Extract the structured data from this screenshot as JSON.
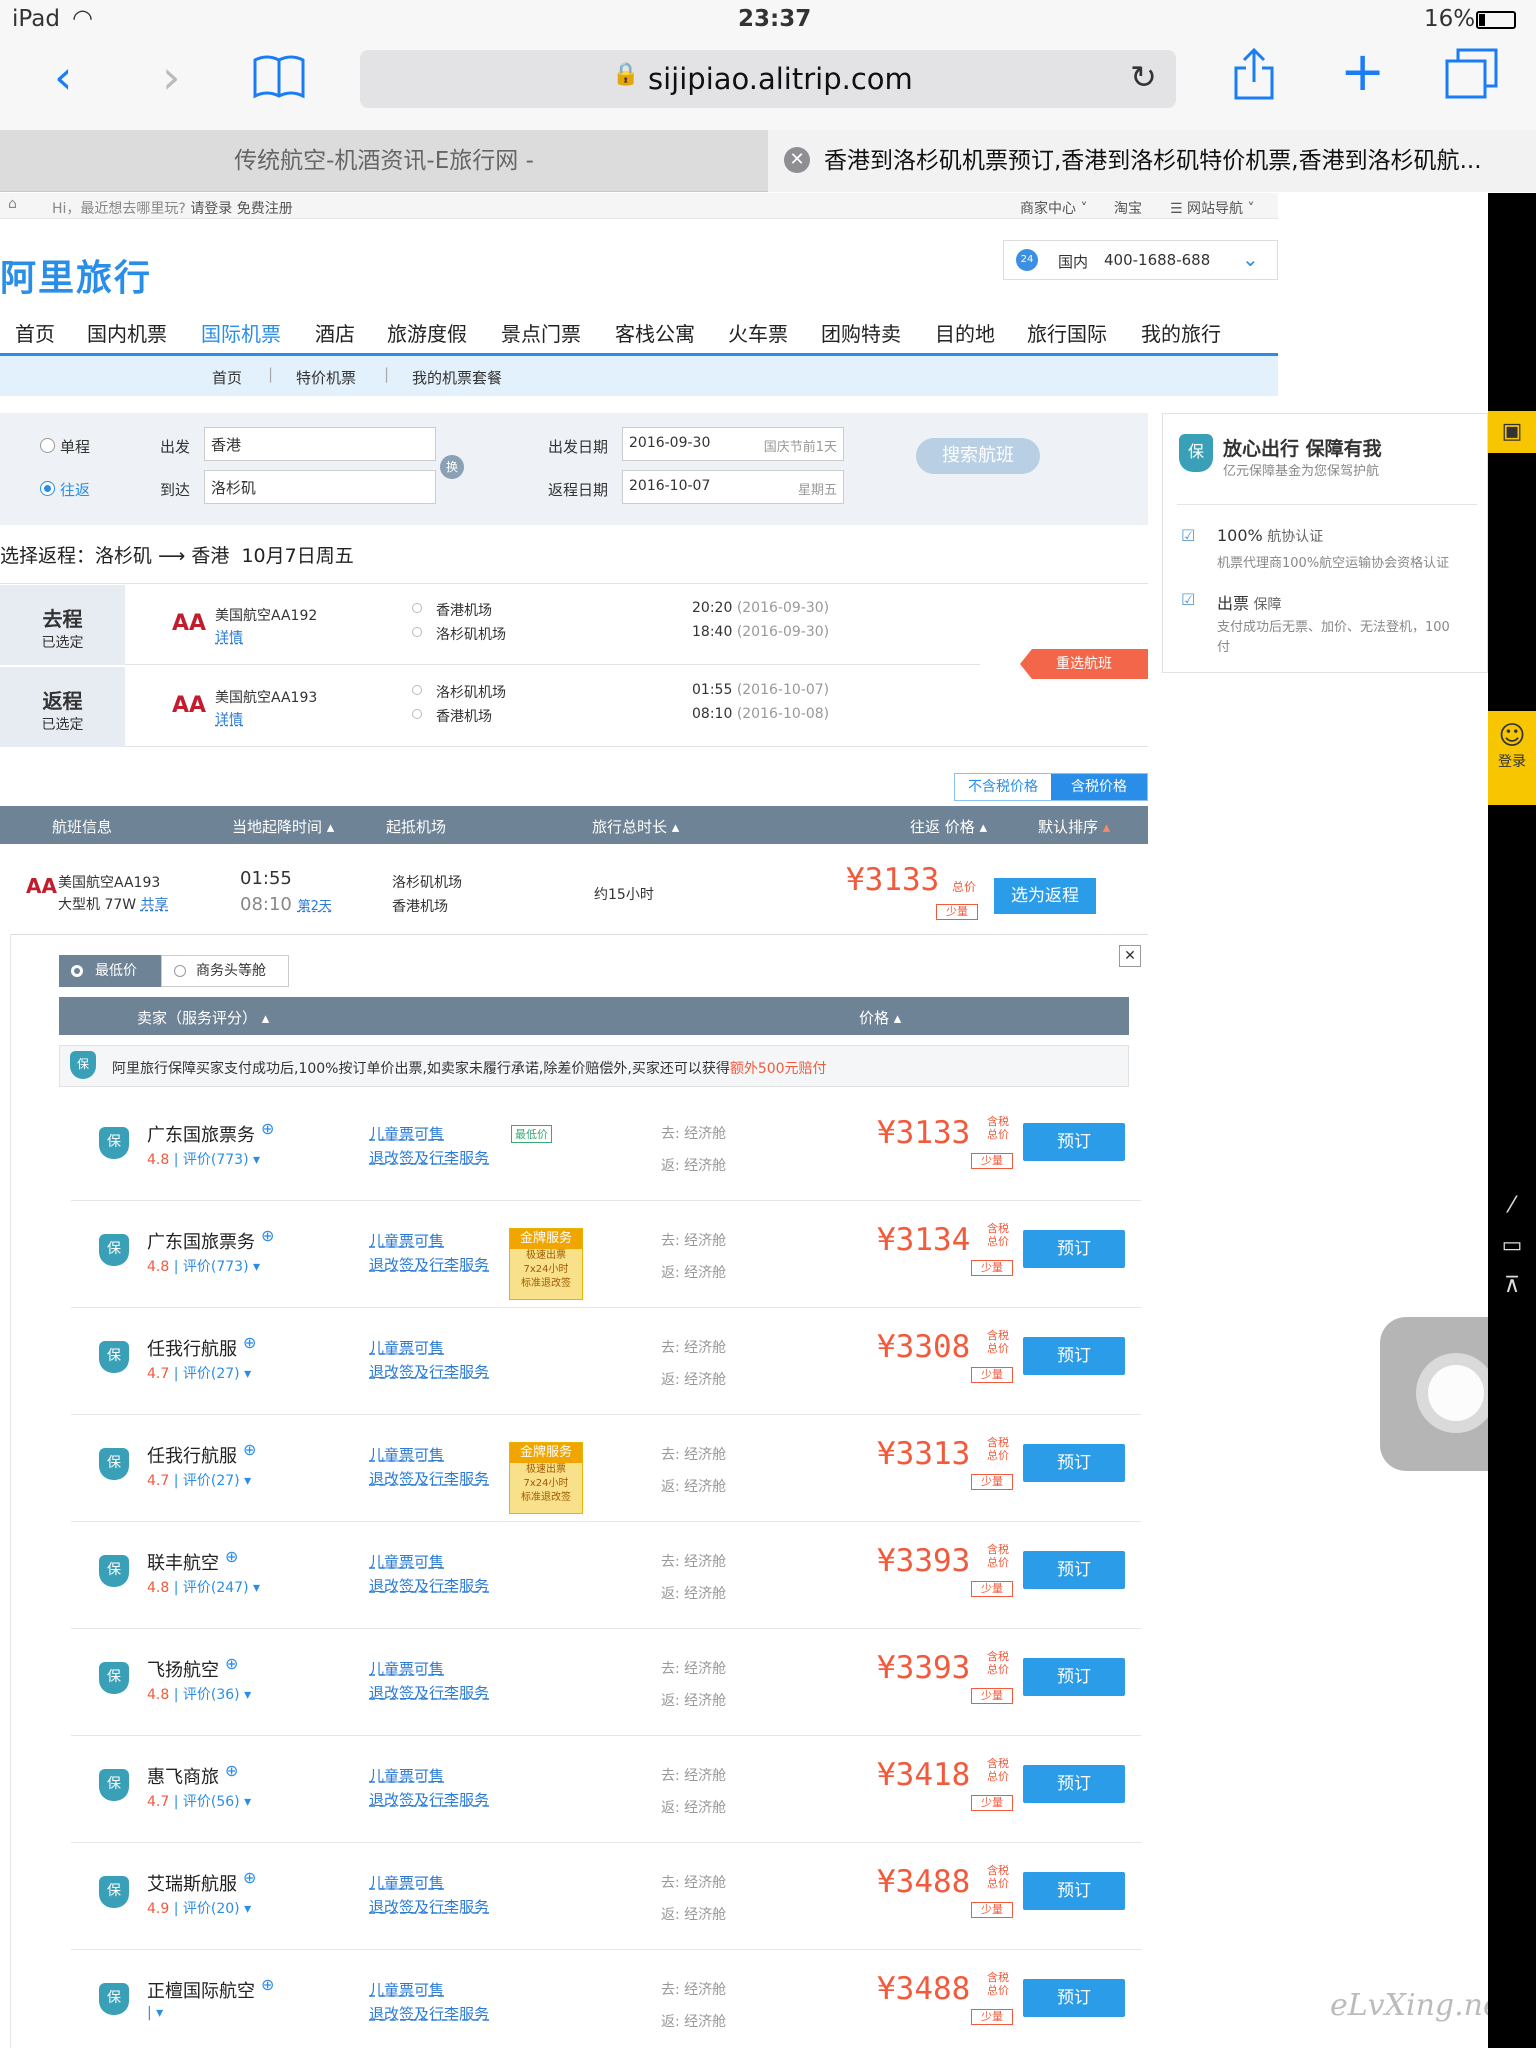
{
  "status": {
    "device": "iPad",
    "time": "23:37",
    "battery": "16%"
  },
  "browser": {
    "url": "sijipiao.alitrip.com"
  },
  "tabs": [
    {
      "title": "传统航空-机酒资讯-E旅行网 -"
    },
    {
      "title": "香港到洛杉矶机票预订,香港到洛杉矶特价机票,香港到洛杉矶航..."
    }
  ],
  "topbar": {
    "greeting": "Hi，最近想去哪里玩? ",
    "login": "请登录",
    "register": "免费注册",
    "merchant": "商家中心",
    "taobao": "淘宝",
    "sitenav": "网站导航"
  },
  "brand": {
    "logo": "阿里旅行",
    "hotline_label": "国内",
    "hotline": "400-1688-688"
  },
  "mainnav": [
    "首页",
    "国内机票",
    "国际机票",
    "酒店",
    "旅游度假",
    "景点门票",
    "客栈公寓",
    "火车票",
    "团购特卖",
    "目的地",
    "旅行国际",
    "我的旅行"
  ],
  "subnav": [
    "首页",
    "特价机票",
    "我的机票套餐"
  ],
  "search": {
    "oneway": "单程",
    "roundtrip": "往返",
    "from_label": "出发",
    "from": "香港",
    "to_label": "到达",
    "to": "洛杉矶",
    "swap": "换",
    "dep_label": "出发日期",
    "dep_date": "2016-09-30",
    "dep_note": "国庆节前1天",
    "ret_label": "返程日期",
    "ret_date": "2016-10-07",
    "ret_note": "星期五",
    "button": "搜索航班"
  },
  "guarantee": {
    "title": "放心出行 保障有我",
    "sub": "亿元保障基金为您保驾护航",
    "item1_title": "100%",
    "item1_title2": " 航协认证",
    "item1_desc": "机票代理商100%航空运输协会资格认证",
    "item2_title": "出票",
    "item2_title2": " 保障",
    "item2_desc": "支付成功后无票、加价、无法登机，100",
    "item2_desc2": "付"
  },
  "select_return": {
    "heading": "选择返程：洛杉矶",
    "arrow": "⟶",
    "dest": "香港",
    "date": "10月7日周五"
  },
  "trips": [
    {
      "label": "去程",
      "status": "已选定",
      "airline": "美国航空AA192",
      "detail": "详情",
      "dep_airport": "香港机场",
      "arr_airport": "洛杉矶机场",
      "dep_time": "20:20",
      "dep_date": "(2016-09-30)",
      "arr_time": "18:40",
      "arr_date": "(2016-09-30)"
    },
    {
      "label": "返程",
      "status": "已选定",
      "airline": "美国航空AA193",
      "detail": "详情",
      "dep_airport": "洛杉矶机场",
      "arr_airport": "香港机场",
      "dep_time": "01:55",
      "dep_date": "(2016-10-07)",
      "arr_time": "08:10",
      "arr_date": "(2016-10-08)"
    }
  ],
  "reselect": "重选航班",
  "tax_toggle": {
    "excl": "不含税价格",
    "incl": "含税价格"
  },
  "list_header": [
    "航班信息",
    "当地起降时间",
    "起抵机场",
    "旅行总时长",
    "往返 价格",
    "默认排序"
  ],
  "flight": {
    "airline": "美国航空AA193",
    "aircraft": "大型机 77W",
    "share": "共享",
    "dep": "01:55",
    "arr": "08:10",
    "nextday": "第2天",
    "dep_airport": "洛杉矶机场",
    "arr_airport": "香港机场",
    "duration": "约15小时",
    "price": "¥3133",
    "price_unit": "总价",
    "few": "少量",
    "button": "选为返程"
  },
  "cabin_tabs": {
    "lowest": "最低价",
    "business": "商务头等舱"
  },
  "seller_header": {
    "seller": "卖家（服务评分）",
    "price": "价格"
  },
  "notice": {
    "text": "阿里旅行保障买家支付成功后,100%按订单价出票,如卖家未履行承诺,除差价赔偿外,买家还可以获得",
    "highlight": "额外500元赔付"
  },
  "sellers": [
    {
      "name": "广东国旅票务",
      "score": "4.8",
      "reviews": "评价(773)",
      "badge": "最低价",
      "price": "¥3133"
    },
    {
      "name": "广东国旅票务",
      "score": "4.8",
      "reviews": "评价(773)",
      "badge": "gold",
      "price": "¥3134"
    },
    {
      "name": "任我行航服",
      "score": "4.7",
      "reviews": "评价(27)",
      "badge": "",
      "price": "¥3308"
    },
    {
      "name": "任我行航服",
      "score": "4.7",
      "reviews": "评价(27)",
      "badge": "gold",
      "price": "¥3313"
    },
    {
      "name": "联丰航空",
      "score": "4.8",
      "reviews": "评价(247)",
      "badge": "",
      "price": "¥3393"
    },
    {
      "name": "飞扬航空",
      "score": "4.8",
      "reviews": "评价(36)",
      "badge": "",
      "price": "¥3393"
    },
    {
      "name": "惠飞商旅",
      "score": "4.7",
      "reviews": "评价(56)",
      "badge": "",
      "price": "¥3418"
    },
    {
      "name": "艾瑞斯航服",
      "score": "4.9",
      "reviews": "评价(20)",
      "badge": "",
      "price": "¥3488"
    },
    {
      "name": "正檀国际航空",
      "score": "",
      "reviews": "",
      "badge": "",
      "price": "¥3488"
    }
  ],
  "seller_common": {
    "child": "儿童票可售",
    "refund": "退改签及行李服务",
    "go": "去: 经济舱",
    "back": "返: 经济舱",
    "tax1": "含税",
    "tax2": "总价",
    "few": "少量",
    "book": "预订",
    "gold_title": "金牌服务",
    "gold_l1": "极速出票",
    "gold_l2": "7x24小时",
    "gold_l3": "标准退改签"
  },
  "side_login": "登录",
  "watermark": "eLvXing.net"
}
